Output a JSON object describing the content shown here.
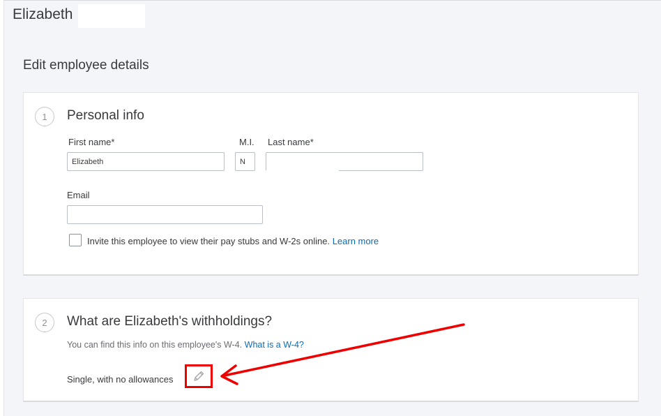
{
  "header": {
    "employee_name": "Elizabeth"
  },
  "page": {
    "title": "Edit employee details"
  },
  "personal_info": {
    "step_number": "1",
    "title": "Personal info",
    "first_name_label": "First name*",
    "first_name_value": "Elizabeth",
    "mi_label": "M.I.",
    "mi_value": "N",
    "last_name_label": "Last name*",
    "last_name_value": "",
    "email_label": "Email",
    "email_value": "",
    "invite_text": "Invite this employee to view their pay stubs and W-2s online.",
    "learn_more_link": "Learn more"
  },
  "withholdings": {
    "step_number": "2",
    "title": "What are Elizabeth's withholdings?",
    "hint_text": "You can find this info on this employee's W-4.",
    "w4_link": "What is a W-4?",
    "status_text": "Single, with no allowances",
    "edit_icon": "pencil-icon"
  },
  "colors": {
    "link": "#0d6baf",
    "annotation": "#ee0000",
    "background": "#f4f5f8"
  }
}
